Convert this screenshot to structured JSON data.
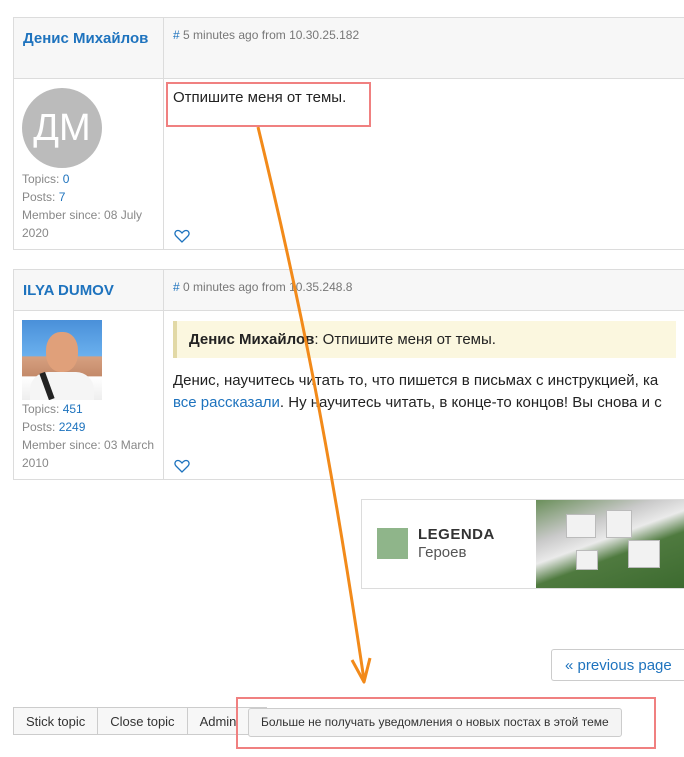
{
  "posts": [
    {
      "author": "Денис Михайлов",
      "hash": "#",
      "meta": " 5 minutes ago from 10.30.25.182",
      "avatar_initials": "ДМ",
      "topics_label": "Topics: ",
      "topics": "0",
      "posts_label": "Posts: ",
      "posts": "7",
      "member_since": "Member since: 08 July 2020",
      "content": "Отпишите меня от темы."
    },
    {
      "author": "ILYA DUMOV",
      "hash": "#",
      "meta": " 0 minutes ago from 10.35.248.8",
      "topics_label": "Topics: ",
      "topics": "451",
      "posts_label": "Posts: ",
      "posts": "2249",
      "member_since": "Member since: 03 March 2010",
      "quote_author": "Денис Михайлов",
      "quote_text": ": Отпишите меня от темы.",
      "content_line1": "Денис, научитесь читать то, что пишется в письмах с инструкцией, ка",
      "content_link": "все рассказали",
      "content_line2": ". Ну научитесь читать, в конце-то концов! Вы снова и с"
    }
  ],
  "ad": {
    "brand": "LEGENDA",
    "subtitle": "Героев"
  },
  "pagination": {
    "previous": "« previous page"
  },
  "admin_bar": {
    "stick": "Stick topic",
    "close": "Close topic",
    "admin": "Admin",
    "notify": "Больше не получать уведомления о новых постах в этой теме"
  },
  "colors": {
    "link": "#1e73be",
    "highlight": "#f08080",
    "arrow": "#f28a1a"
  },
  "icons": {
    "heart": "heart-outline-icon",
    "arrow": "annotation-arrow"
  }
}
